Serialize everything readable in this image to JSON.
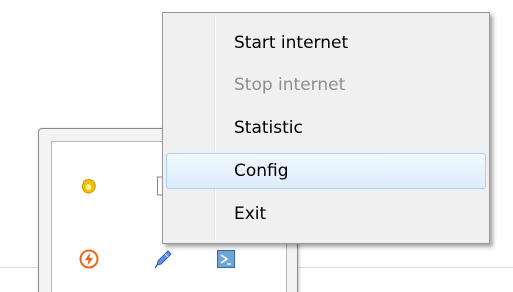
{
  "context_menu": {
    "items": [
      {
        "label": "Start internet",
        "enabled": true,
        "highlighted": false
      },
      {
        "label": "Stop internet",
        "enabled": false,
        "highlighted": false
      },
      {
        "label": "Statistic",
        "enabled": true,
        "highlighted": false
      },
      {
        "label": "Config",
        "enabled": true,
        "highlighted": true
      },
      {
        "label": "Exit",
        "enabled": true,
        "highlighted": false
      }
    ]
  },
  "tray": {
    "icons": [
      {
        "name": "yellow-app-icon",
        "color": "#f2c200"
      },
      {
        "name": "lightning-icon",
        "color": "#e8671a"
      },
      {
        "name": "pen-icon",
        "color": "#3a78d8"
      },
      {
        "name": "terminal-icon",
        "color": "#2f6da8"
      }
    ]
  },
  "colors": {
    "menu_bg": "#f0f0f0",
    "highlight_border": "#a8d2f3",
    "disabled_text": "#8d8d8d"
  }
}
